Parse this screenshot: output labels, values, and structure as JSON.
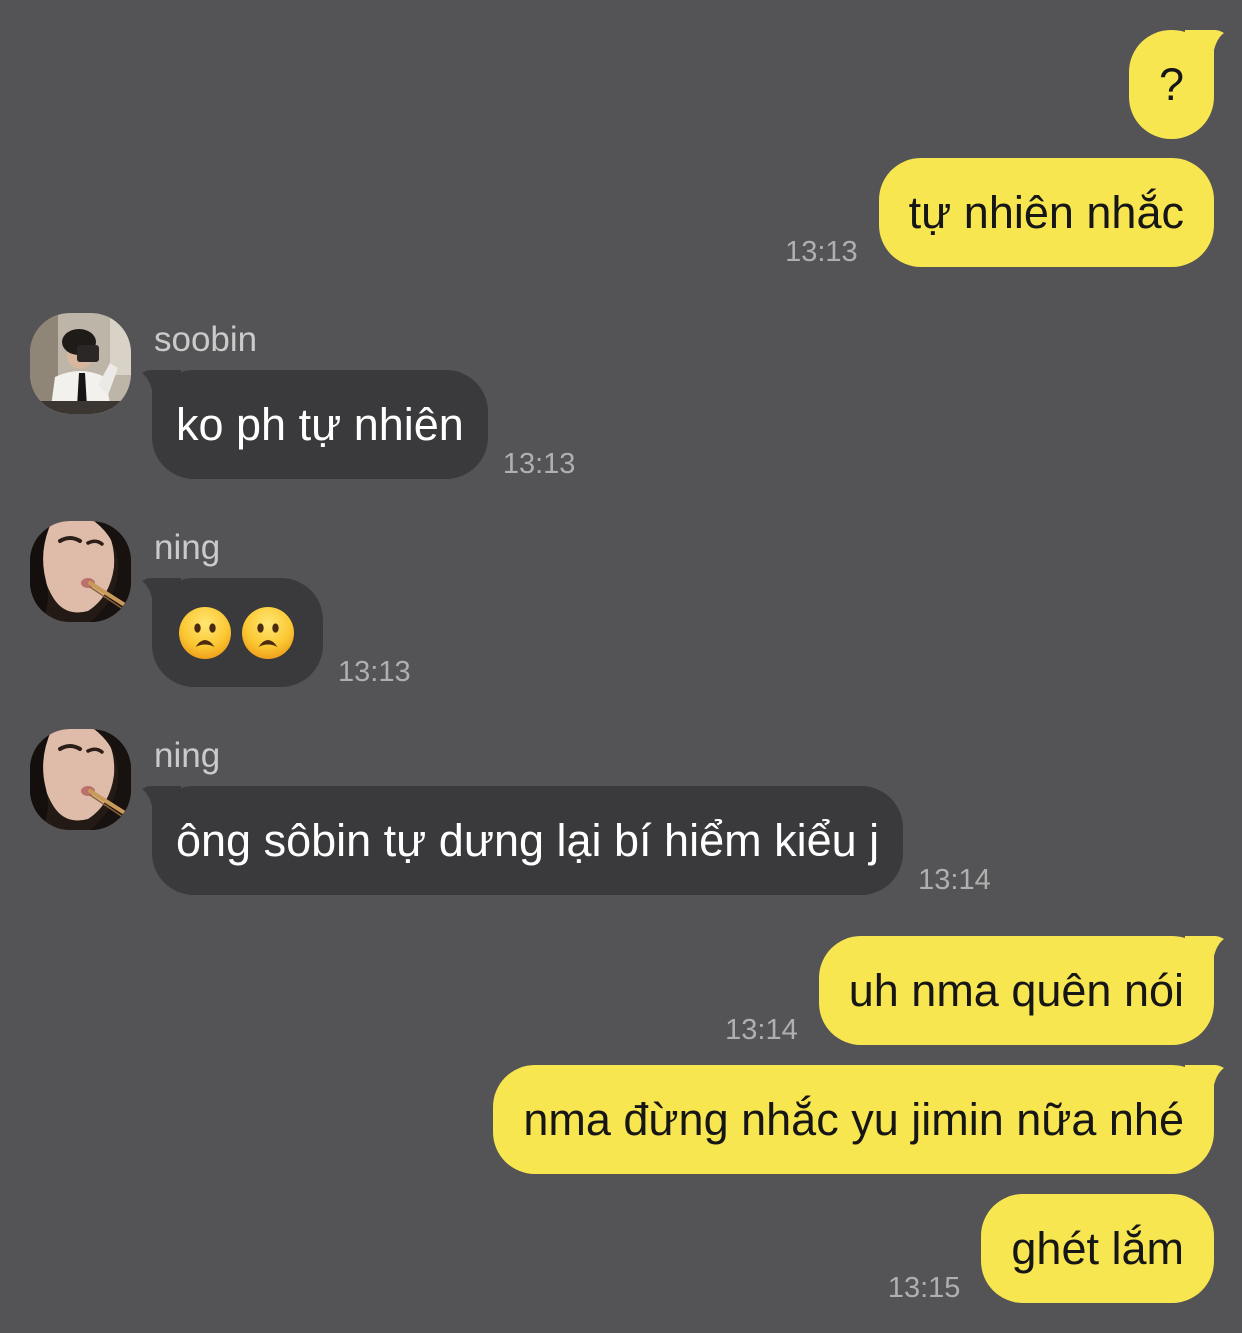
{
  "theme": {
    "background": "#545355",
    "outgoing_bubble": "#F8E650",
    "incoming_bubble": "#3A393B"
  },
  "chat": {
    "messages": [
      {
        "outgoing": true,
        "text": "?"
      },
      {
        "outgoing": true,
        "text": "tự nhiên nhắc",
        "time": "13:13"
      },
      {
        "outgoing": false,
        "sender": "soobin",
        "text": "ko ph tự nhiên",
        "time": "13:13"
      },
      {
        "outgoing": false,
        "sender": "ning",
        "emojis": [
          "frowning-face-with-open-mouth-icon",
          "frowning-face-with-open-mouth-icon"
        ],
        "time": "13:13"
      },
      {
        "outgoing": false,
        "sender": "ning",
        "text": "ông sôbin tự dưng lại bí hiểm kiểu j",
        "time": "13:14"
      },
      {
        "outgoing": true,
        "text": "uh nma quên nói",
        "time": "13:14"
      },
      {
        "outgoing": true,
        "text": "nma đừng nhắc yu jimin nữa nhé"
      },
      {
        "outgoing": true,
        "text": "ghét lắm",
        "time": "13:15"
      }
    ]
  }
}
